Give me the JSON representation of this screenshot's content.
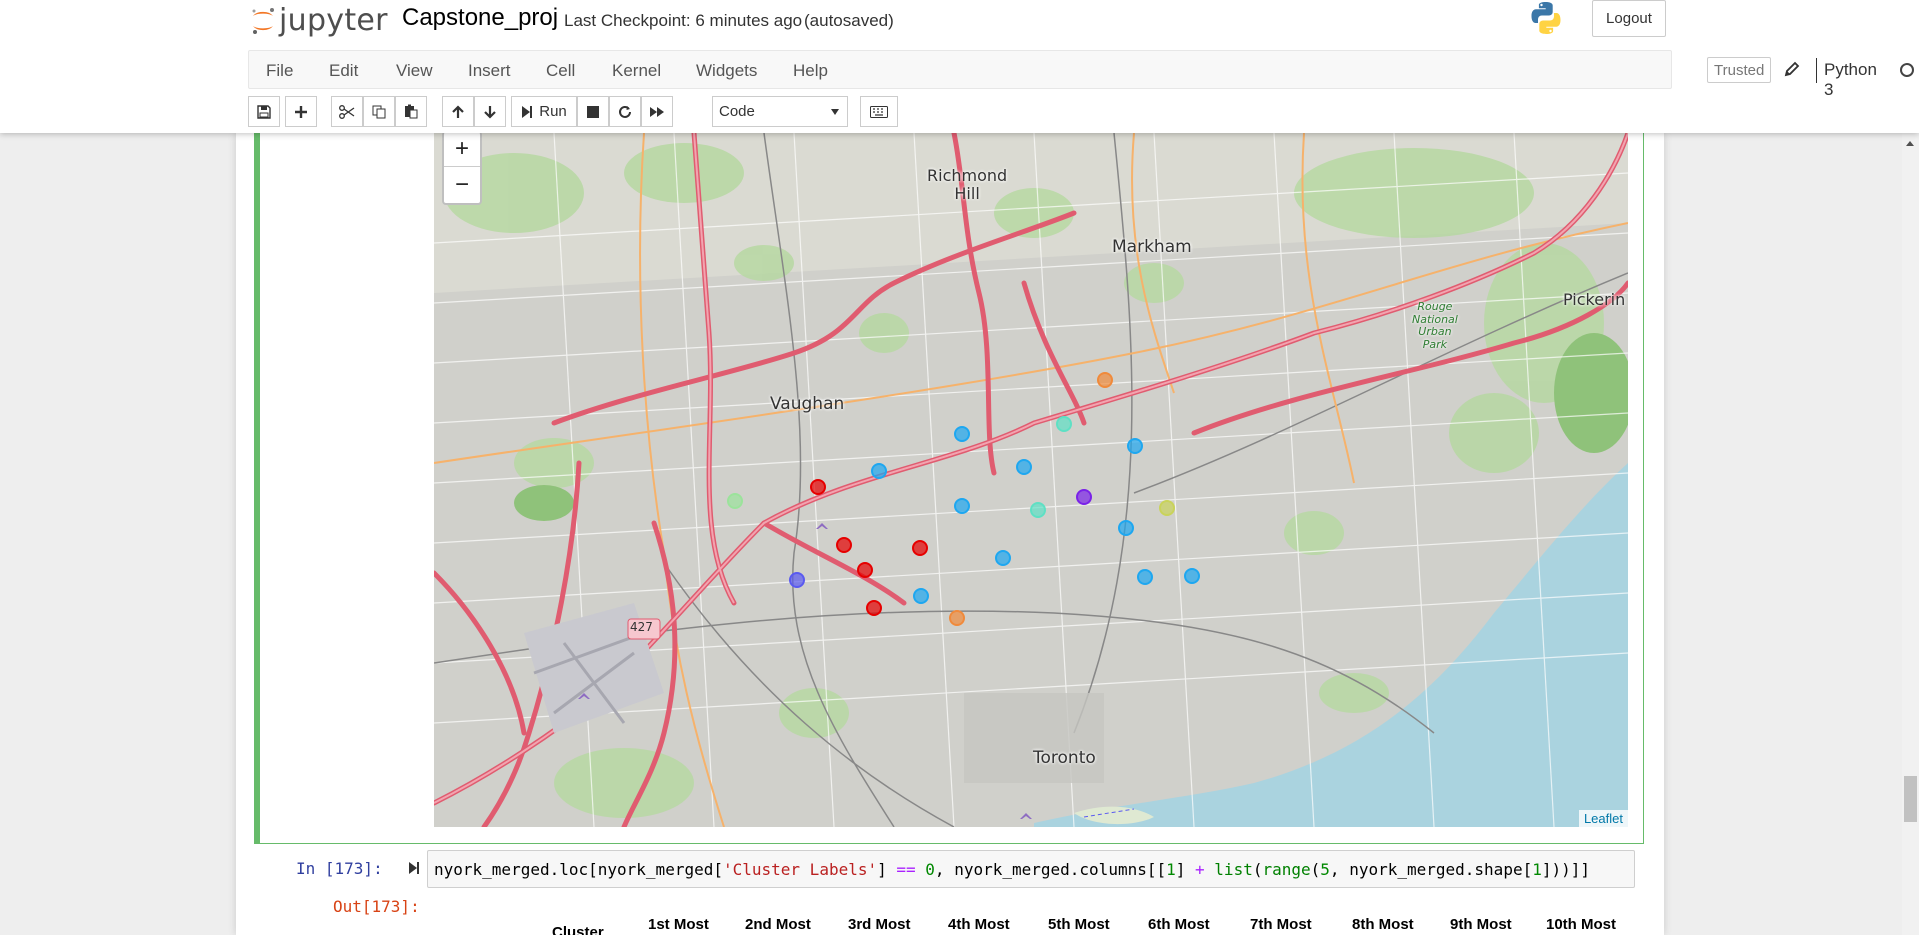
{
  "header": {
    "logo_text": "jupyter",
    "notebook_name": "Capstone_proj",
    "checkpoint": "Last Checkpoint: 6 minutes ago",
    "autosave": "(autosaved)",
    "logout_label": "Logout"
  },
  "menu": {
    "items": [
      "File",
      "Edit",
      "View",
      "Insert",
      "Cell",
      "Kernel",
      "Widgets",
      "Help"
    ],
    "trusted_label": "Trusted",
    "kernel_name": "Python 3"
  },
  "toolbar": {
    "run_label": "Run",
    "cell_type": "Code"
  },
  "map": {
    "attribution": "Leaflet",
    "zoom_in": "+",
    "zoom_out": "−",
    "places": [
      {
        "name": "Richmond Hill",
        "lines": [
          "Richmond",
          "Hill"
        ]
      },
      {
        "name": "Markham",
        "lines": [
          "Markham"
        ]
      },
      {
        "name": "Vaughan",
        "lines": [
          "Vaughan"
        ]
      },
      {
        "name": "Pickering",
        "lines": [
          "Pickerin"
        ]
      },
      {
        "name": "Toronto",
        "lines": [
          "Toronto"
        ]
      },
      {
        "name": "Rouge National Urban Park",
        "lines": [
          "Rouge",
          "National",
          "Urban",
          "Park"
        ]
      }
    ],
    "highway_shield": "427",
    "cluster_colors": {
      "red": "#e60000",
      "blue": "#1ea7f0",
      "orange": "#f08a3b",
      "cyan": "#5ee0c4",
      "purple": "#7a22e8",
      "indigo": "#5a5af0",
      "olive": "#c9d35a",
      "lightgreen": "#9be39b"
    }
  },
  "cells": {
    "in_prompt": "In [173]:",
    "out_prompt": "Out[173]:",
    "code_parts": [
      {
        "t": "nyork_merged.loc[nyork_merged[",
        "c": "var"
      },
      {
        "t": "'Cluster Labels'",
        "c": "str"
      },
      {
        "t": "] ",
        "c": "var"
      },
      {
        "t": "==",
        "c": "op"
      },
      {
        "t": " ",
        "c": "var"
      },
      {
        "t": "0",
        "c": "num"
      },
      {
        "t": ", nyork_merged.columns[[",
        "c": "var"
      },
      {
        "t": "1",
        "c": "num"
      },
      {
        "t": "] ",
        "c": "var"
      },
      {
        "t": "+",
        "c": "op"
      },
      {
        "t": " ",
        "c": "var"
      },
      {
        "t": "list",
        "c": "fn"
      },
      {
        "t": "(",
        "c": "var"
      },
      {
        "t": "range",
        "c": "fn"
      },
      {
        "t": "(",
        "c": "var"
      },
      {
        "t": "5",
        "c": "num"
      },
      {
        "t": ", nyork_merged.shape[",
        "c": "var"
      },
      {
        "t": "1",
        "c": "num"
      },
      {
        "t": "]))]]",
        "c": "var"
      }
    ],
    "table_headers": [
      "Cluster",
      "1st Most",
      "2nd Most",
      "3rd Most",
      "4th Most",
      "5th Most",
      "6th Most",
      "7th Most",
      "8th Most",
      "9th Most",
      "10th Most"
    ]
  }
}
